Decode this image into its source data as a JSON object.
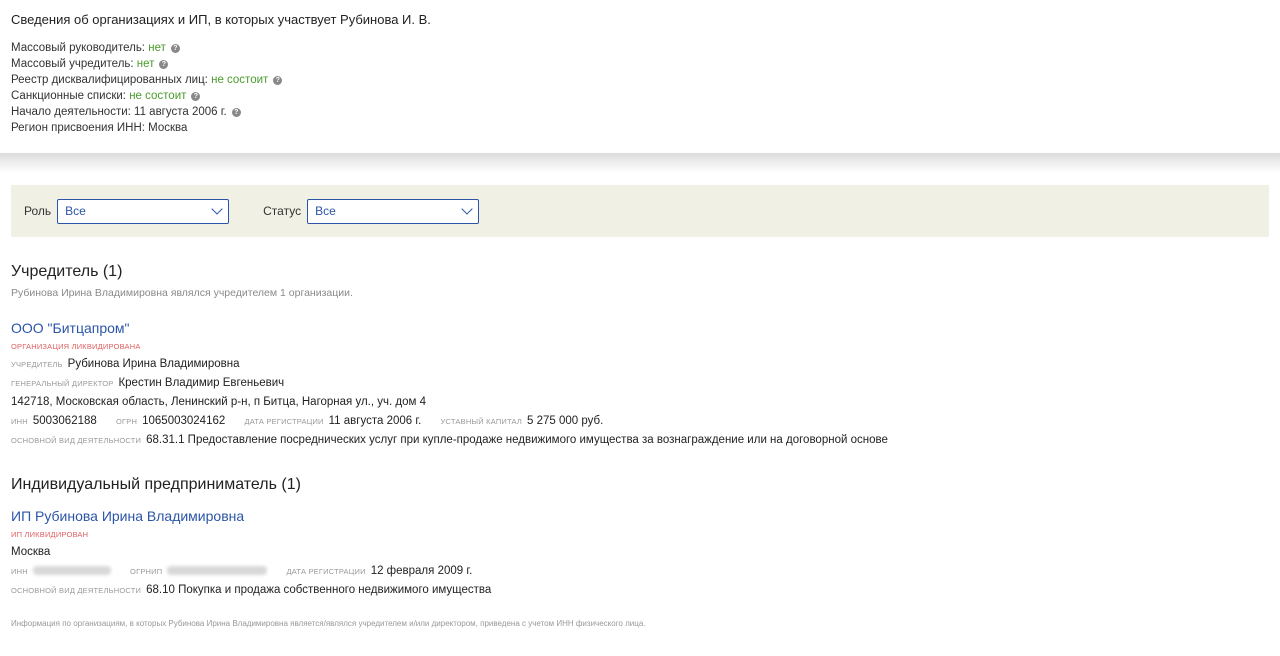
{
  "header": {
    "title": "Сведения об организациях и ИП, в которых участвует Рубинова И. В.",
    "facts": [
      {
        "label": "Массовый руководитель:",
        "value": "нет",
        "green": true,
        "help": true
      },
      {
        "label": "Массовый учредитель:",
        "value": "нет",
        "green": true,
        "help": true
      },
      {
        "label": "Реестр дисквалифицированных лиц:",
        "value": "не состоит",
        "green": true,
        "help": true
      },
      {
        "label": "Санкционные списки:",
        "value": "не состоит",
        "green": true,
        "help": true
      },
      {
        "label": "Начало деятельности:",
        "value": "11 августа 2006 г.",
        "green": false,
        "help": true
      },
      {
        "label": "Регион присвоения ИНН:",
        "value": "Москва",
        "green": false,
        "help": false
      }
    ]
  },
  "filters": {
    "role_label": "Роль",
    "role_value": "Все",
    "status_label": "Статус",
    "status_value": "Все"
  },
  "founder": {
    "heading": "Учредитель (1)",
    "subtitle": "Рубинова Ирина Владимировна являлся учредителем 1 организации.",
    "org": {
      "name": "ООО \"Битцапром\"",
      "status": "организация ликвидирована",
      "founder_label": "учредитель",
      "founder": "Рубинова Ирина Владимировна",
      "director_label": "генеральный директор",
      "director": "Крестин Владимир Евгеньевич",
      "address": "142718, Московская область, Ленинский р-н, п Битца, Нагорная ул., уч. дом 4",
      "inn_label": "инн",
      "inn": "5003062188",
      "ogrn_label": "огрн",
      "ogrn": "1065003024162",
      "reg_label": "дата регистрации",
      "reg": "11 августа 2006 г.",
      "capital_label": "уставный капитал",
      "capital": "5 275 000 руб.",
      "activity_label": "основной вид деятельности",
      "activity": "68.31.1 Предоставление посреднических услуг при купле-продаже недвижимого имущества за вознаграждение или на договорной основе"
    }
  },
  "entrepreneur": {
    "heading": "Индивидуальный предприниматель (1)",
    "ip": {
      "name": "ИП Рубинова Ирина Владимировна",
      "status": "ип ликвидирован",
      "city": "Москва",
      "inn_label": "инн",
      "ogrnip_label": "огрнип",
      "reg_label": "дата регистрации",
      "reg": "12 февраля 2009 г.",
      "activity_label": "основной вид деятельности",
      "activity": "68.10 Покупка и продажа собственного недвижимого имущества"
    }
  },
  "footnote": "Информация по организациям, в которых Рубинова Ирина Владимировна является/являлся учредителем и/или директором, приведена с учетом ИНН физического лица."
}
